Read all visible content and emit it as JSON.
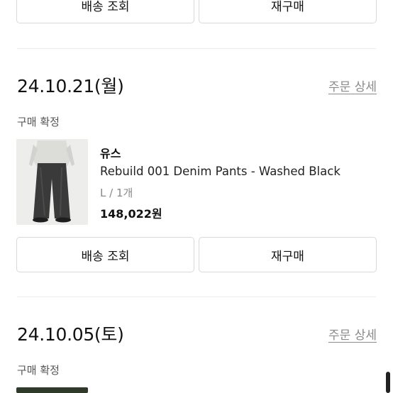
{
  "top_buttons": {
    "track": "배송 조회",
    "reorder": "재구매"
  },
  "orders": [
    {
      "date": "24.10.21(월)",
      "detail_link": "주문 상세",
      "status": "구매 확정",
      "brand": "유스",
      "product_name": "Rebuild 001 Denim Pants - Washed Black",
      "option": "L / 1개",
      "price": "148,022원",
      "track_button": "배송 조회",
      "reorder_button": "재구매"
    },
    {
      "date": "24.10.05(토)",
      "detail_link": "주문 상세",
      "status": "구매 확정"
    }
  ]
}
